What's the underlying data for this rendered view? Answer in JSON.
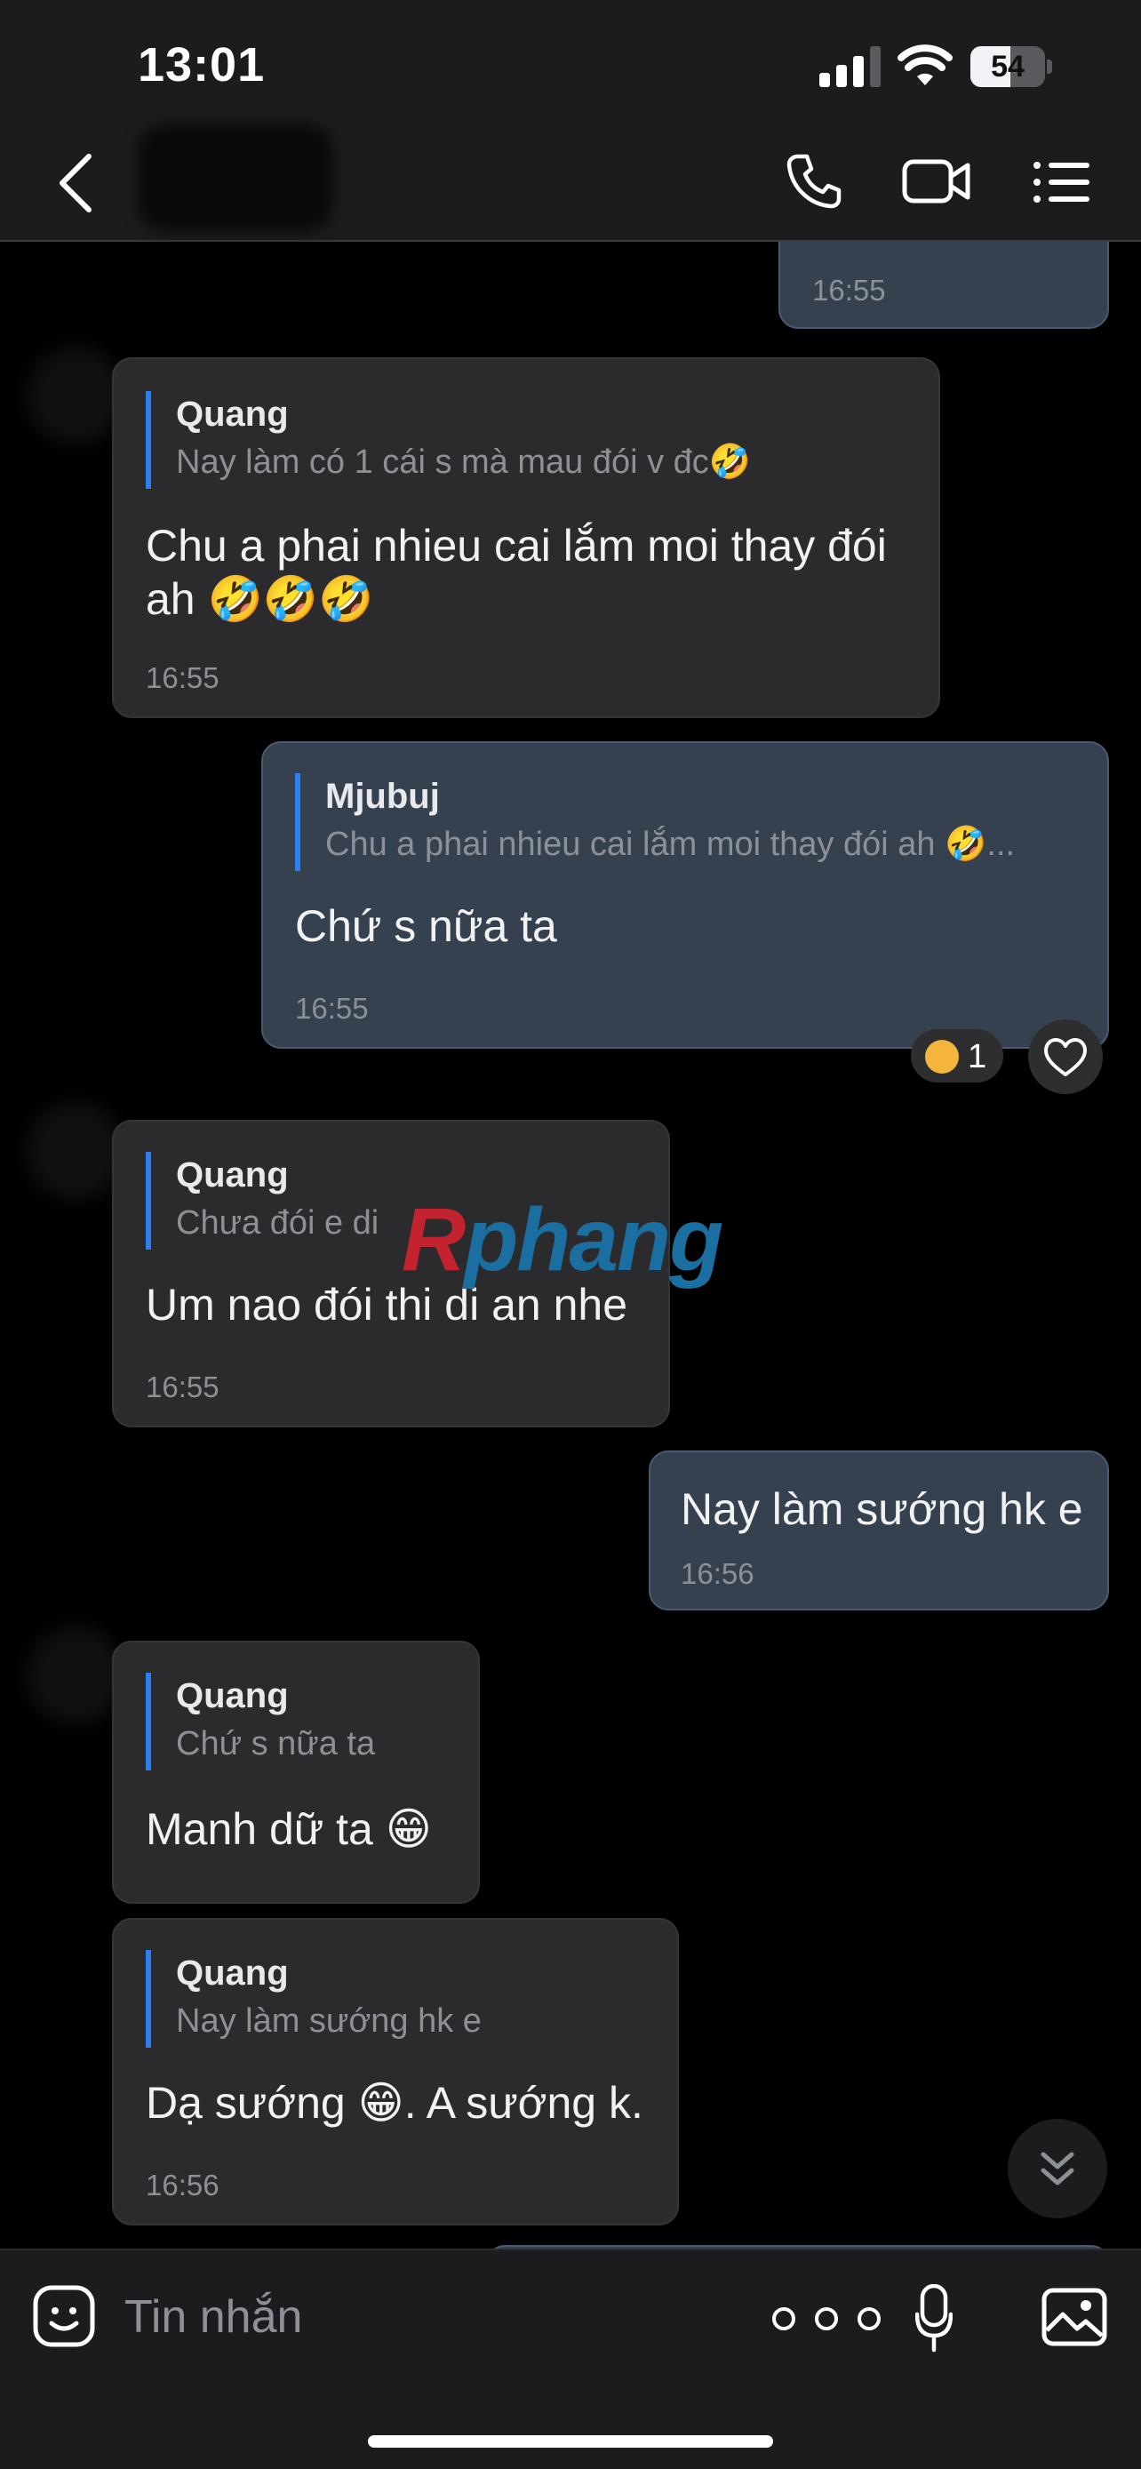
{
  "status_bar": {
    "time": "13:01",
    "battery_percent": "54",
    "battery_level": 0.54
  },
  "header": {
    "back_icon": "chevron-left-icon",
    "call_icon": "phone-icon",
    "video_icon": "video-camera-icon",
    "menu_icon": "list-icon"
  },
  "accent_colors": {
    "reply_bar": "#2e7ff1",
    "outgoing_bubble": "#364150",
    "incoming_bubble": "#2b2b2d"
  },
  "messages": [
    {
      "direction": "out",
      "time": "16:55"
    },
    {
      "direction": "in",
      "reply_name": "Quang",
      "reply_text": "Nay làm có 1 cái s mà mau đói v đc🤣",
      "text_line1": "Chu a phai nhieu cai lắm moi thay đói",
      "text_line2": "ah 🤣🤣🤣",
      "time": "16:55"
    },
    {
      "direction": "out",
      "reply_name": "Mjubuj",
      "reply_text": "Chu a phai nhieu cai lắm moi thay đói ah 🤣...",
      "text": "Chứ s nữa ta",
      "time": "16:55",
      "reaction_count": "1"
    },
    {
      "direction": "in",
      "reply_name": "Quang",
      "reply_text": "Chưa đói e di",
      "text": "Um nao đói thi di an nhe",
      "time": "16:55"
    },
    {
      "direction": "out",
      "text": "Nay làm sướng hk e",
      "time": "16:56"
    },
    {
      "direction": "in",
      "reply_name": "Quang",
      "reply_text": "Chứ s nữa ta",
      "text": "Manh dữ ta 😁"
    },
    {
      "direction": "in",
      "reply_name": "Quang",
      "reply_text": "Nay làm sướng hk e",
      "text": "Dạ sướng 😁. A sướng k.",
      "time": "16:56"
    }
  ],
  "watermark": {
    "first": "R",
    "rest": "phang"
  },
  "composer": {
    "placeholder": "Tin nhắn",
    "sticker_icon": "sticker-face-icon",
    "more_icon": "more-dots-icon",
    "mic_icon": "microphone-icon",
    "image_icon": "image-icon"
  }
}
